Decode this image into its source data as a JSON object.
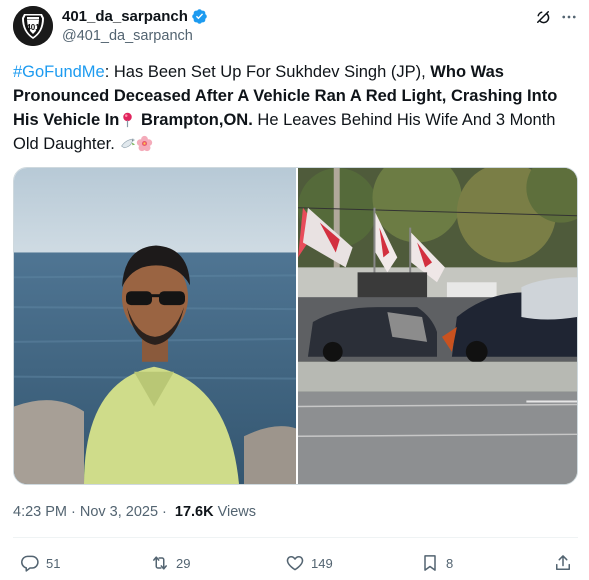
{
  "user": {
    "display_name": "401_da_sarpanch",
    "handle": "@401_da_sarpanch",
    "avatar_text": "401",
    "verified": true
  },
  "tweet": {
    "hashtag": "#GoFundMe",
    "text_1": ": Has Been Set Up For Sukhdev Singh (JP), ",
    "bold_1": "Who Was Pronounced Deceased After A Vehicle Ran A Red Light, Crashing Into His Vehicle In",
    "bold_2": " Brampton,ON.",
    "text_2": " He Leaves Behind His Wife And 3 Month Old Daughter.",
    "emoji_pin": "pin-icon",
    "emoji_dove": "dove-icon",
    "emoji_flower": "flower-icon"
  },
  "meta": {
    "time": "4:23 PM",
    "separator": "·",
    "date": "Nov 3, 2025",
    "views_count": "17.6K",
    "views_label": "Views"
  },
  "actions": {
    "replies": "51",
    "reposts": "29",
    "likes": "149",
    "bookmarks": "8"
  },
  "colors": {
    "accent": "#1d9bf0",
    "text": "#0f1419",
    "muted": "#536471",
    "border": "#cfd9de"
  }
}
